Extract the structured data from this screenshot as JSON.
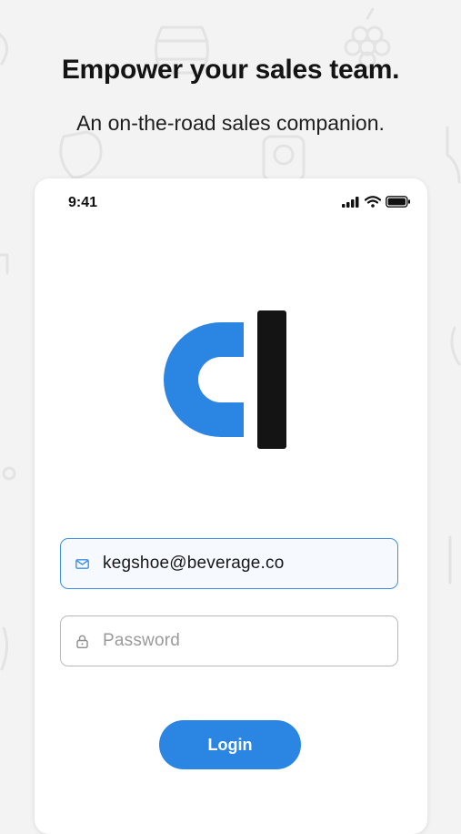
{
  "hero": {
    "headline": "Empower your sales team.",
    "subline": "An on-the-road sales companion."
  },
  "status_bar": {
    "time": "9:41",
    "icons": [
      "cellular-signal-icon",
      "wifi-icon",
      "battery-icon"
    ]
  },
  "logo": {
    "name": "app-logo",
    "colors": {
      "left": "#2b86e3",
      "right": "#111111"
    }
  },
  "login_form": {
    "email": {
      "value": "kegshoe@beverage.co",
      "icon": "mail-icon"
    },
    "password": {
      "placeholder": "Password",
      "icon": "lock-icon"
    },
    "login_label": "Login"
  },
  "colors": {
    "accent": "#2b86e3",
    "background": "#f3f3f3",
    "card": "#ffffff"
  }
}
